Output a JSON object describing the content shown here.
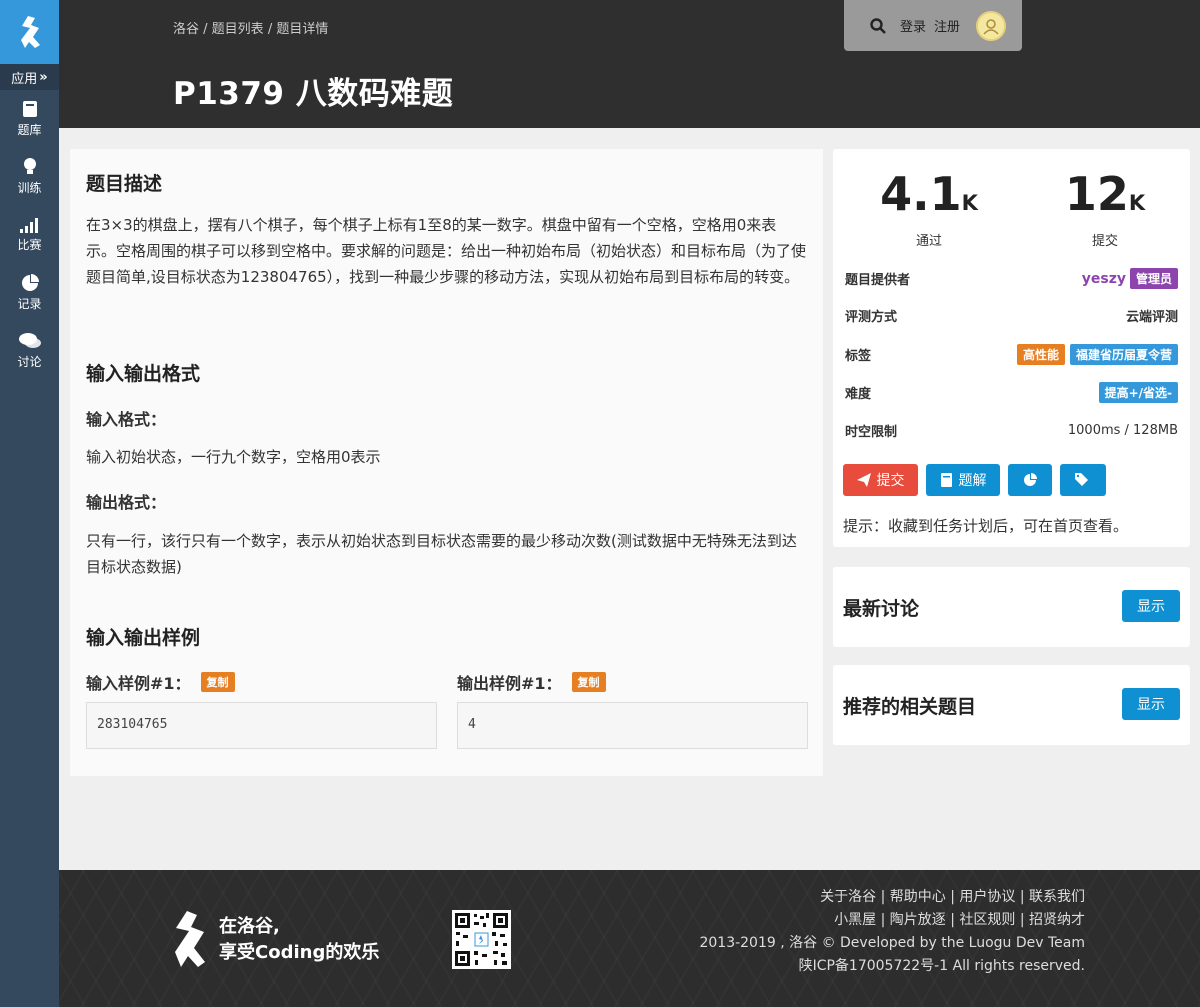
{
  "sidebar": {
    "apps_label": "应用",
    "items": [
      {
        "label": "题库",
        "icon": "book-icon"
      },
      {
        "label": "训练",
        "icon": "lightbulb-icon"
      },
      {
        "label": "比赛",
        "icon": "signal-bars-icon"
      },
      {
        "label": "记录",
        "icon": "pie-chart-icon"
      },
      {
        "label": "讨论",
        "icon": "comments-icon"
      }
    ]
  },
  "header": {
    "breadcrumb": [
      "洛谷",
      "题目列表",
      "题目详情"
    ],
    "breadcrumb_sep": " / ",
    "title": "P1379 八数码难题",
    "login": "登录",
    "register": "注册"
  },
  "problem": {
    "desc_title": "题目描述",
    "desc_text": "在3×3的棋盘上，摆有八个棋子，每个棋子上标有1至8的某一数字。棋盘中留有一个空格，空格用0来表示。空格周围的棋子可以移到空格中。要求解的问题是：给出一种初始布局（初始状态）和目标布局（为了使题目简单,设目标状态为123804765），找到一种最少步骤的移动方法，实现从初始布局到目标布局的转变。",
    "io_title": "输入输出格式",
    "input_label": "输入格式：",
    "input_text": "输入初始状态，一行九个数字，空格用0表示",
    "output_label": "输出格式：",
    "output_text": "只有一行，该行只有一个数字，表示从初始状态到目标状态需要的最少移动次数(测试数据中无特殊无法到达目标状态数据)",
    "sample_title": "输入输出样例",
    "sample_in_label": "输入样例#1：",
    "sample_out_label": "输出样例#1：",
    "copy_label": "复制",
    "sample_in": "283104765",
    "sample_out": "4"
  },
  "info": {
    "pass_num": "4.1",
    "pass_unit": "K",
    "pass_label": "通过",
    "submit_num": "12",
    "submit_unit": "K",
    "submit_label": "提交",
    "provider_label": "题目提供者",
    "provider_name": "yeszy",
    "provider_role": "管理员",
    "judge_label": "评测方式",
    "judge_value": "云端评测",
    "tags_label": "标签",
    "tags": [
      "高性能",
      "福建省历届夏令营"
    ],
    "difficulty_label": "难度",
    "difficulty_value": "提高+/省选-",
    "limit_label": "时空限制",
    "limit_value": "1000ms / 128MB",
    "btn_submit": "提交",
    "btn_solution": "题解",
    "hint": "提示：收藏到任务计划后，可在首页查看。",
    "colors": {
      "submit": "#e74c3c",
      "primary": "#0e90d2",
      "purple": "#8e44ad",
      "orange": "#e67e22",
      "blue": "#3498db"
    }
  },
  "discuss": {
    "title": "最新讨论",
    "button": "显示"
  },
  "related": {
    "title": "推荐的相关题目",
    "button": "显示"
  },
  "footer": {
    "slogan_line1": "在洛谷,",
    "slogan_line2": "享受Coding的欢乐",
    "links_line1": "关于洛谷 | 帮助中心 | 用户协议 | 联系我们",
    "links_line2": "小黑屋 | 陶片放逐 | 社区规则 | 招贤纳才",
    "copyright": "2013-2019 , 洛谷 © Developed by the Luogu Dev Team",
    "icp": "陕ICP备17005722号-1 All rights reserved."
  }
}
